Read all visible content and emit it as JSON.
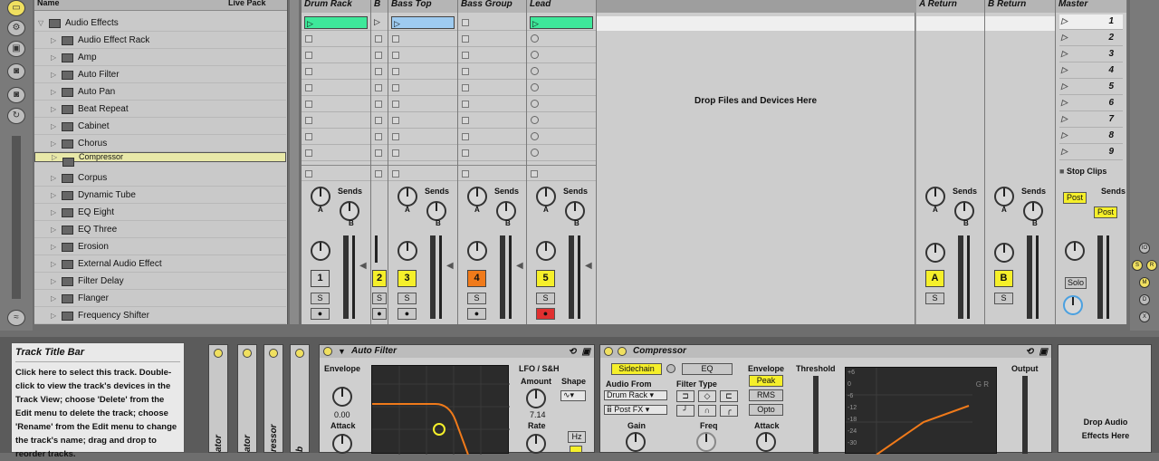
{
  "browser": {
    "header_name": "Name",
    "header_pack": "Live Pack",
    "root": "Audio Effects",
    "items": [
      "Audio Effect Rack",
      "Amp",
      "Auto Filter",
      "Auto Pan",
      "Beat Repeat",
      "Cabinet",
      "Chorus",
      "Compressor",
      "Corpus",
      "Dynamic Tube",
      "EQ Eight",
      "EQ Three",
      "Erosion",
      "External Audio Effect",
      "Filter Delay",
      "Flanger",
      "Frequency Shifter"
    ],
    "selected": "Compressor"
  },
  "tracks": [
    {
      "name": "Drum Rack",
      "number": "1",
      "color": "#cfcfcf"
    },
    {
      "name": "B",
      "number": "2",
      "color": "#f5ef2a"
    },
    {
      "name": "Bass Top",
      "number": "3",
      "color": "#f5ef2a"
    },
    {
      "name": "Bass Group",
      "number": "4",
      "color": "#f07a1a"
    },
    {
      "name": "Lead",
      "number": "5",
      "color": "#f5ef2a"
    }
  ],
  "returns": [
    {
      "name": "A Return",
      "letter": "A"
    },
    {
      "name": "B Return",
      "letter": "B"
    }
  ],
  "master": {
    "name": "Master",
    "scenes": [
      "1",
      "2",
      "3",
      "4",
      "5",
      "6",
      "7",
      "8",
      "9"
    ],
    "stop_clips": "Stop Clips",
    "post": "Post",
    "solo": "Solo"
  },
  "session": {
    "drop_text": "Drop Files and Devices Here",
    "sends": "Sends",
    "solo": "S",
    "send_a": "A",
    "send_b": "B"
  },
  "info": {
    "title": "Track Title Bar",
    "body": "Click here to select this track. Double-click to view the track's devices in the Track View; choose 'Delete' from the Edit menu to delete the track; choose 'Rename' from the Edit menu to change the track's name; drag and drop to reorder tracks."
  },
  "devices": {
    "narrow_labels": [
      "ator",
      "ator",
      "ressor",
      "b"
    ],
    "auto_filter": {
      "title": "Auto Filter",
      "envelope": "Envelope",
      "env_value": "0.00",
      "attack": "Attack",
      "lfo": "LFO / S&H",
      "amount": "Amount",
      "shape": "Shape",
      "amount_value": "7.14",
      "rate": "Rate",
      "hz": "Hz"
    },
    "compressor": {
      "title": "Compressor",
      "sidechain": "Sidechain",
      "eq": "EQ",
      "audio_from": "Audio From",
      "source": "Drum Rack",
      "post_fx": "Post FX",
      "gain": "Gain",
      "filter_type": "Filter Type",
      "freq": "Freq",
      "envelope": "Envelope",
      "modes": [
        "Peak",
        "RMS",
        "Opto"
      ],
      "attack": "Attack",
      "threshold": "Threshold",
      "output": "Output",
      "gr": "G R",
      "scale": [
        "+6",
        "0",
        "-6",
        "-12",
        "-18",
        "-24",
        "-30"
      ]
    },
    "drop_audio": "Drop Audio Effects Here"
  },
  "colors": {
    "clip_green": "#3ee89a",
    "clip_blue": "#9ecbf0",
    "yellow": "#f5ef2a",
    "orange": "#f07a1a",
    "red": "#e03030"
  }
}
